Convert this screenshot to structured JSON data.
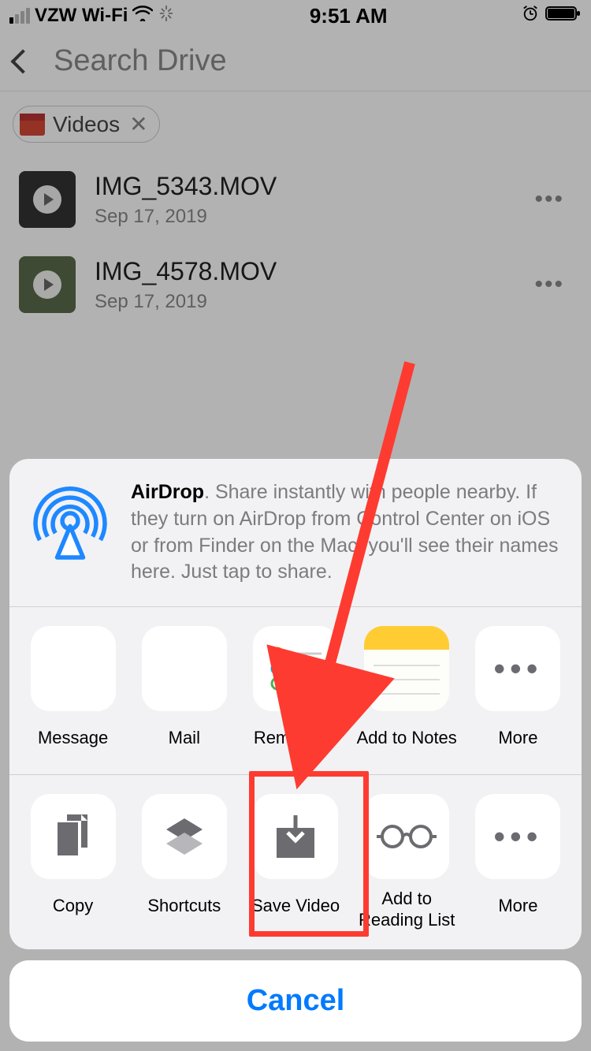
{
  "status": {
    "carrier": "VZW Wi-Fi",
    "time": "9:51 AM"
  },
  "nav": {
    "placeholder": "Search Drive"
  },
  "filter_chip": {
    "label": "Videos"
  },
  "files": [
    {
      "name": "IMG_5343.MOV",
      "date": "Sep 17, 2019"
    },
    {
      "name": "IMG_4578.MOV",
      "date": "Sep 17, 2019"
    }
  ],
  "share": {
    "airdrop_title": "AirDrop",
    "airdrop_body": ". Share instantly with people nearby. If they turn on AirDrop from Control Center on iOS or from Finder on the Mac, you'll see their names here. Just tap to share.",
    "apps": [
      {
        "label": "Message"
      },
      {
        "label": "Mail"
      },
      {
        "label": "Reminders"
      },
      {
        "label": "Add to Notes"
      },
      {
        "label": "More"
      }
    ],
    "actions": [
      {
        "label": "Copy"
      },
      {
        "label": "Shortcuts"
      },
      {
        "label": "Save Video"
      },
      {
        "label": "Add to Reading List"
      },
      {
        "label": "More"
      }
    ],
    "cancel": "Cancel"
  }
}
